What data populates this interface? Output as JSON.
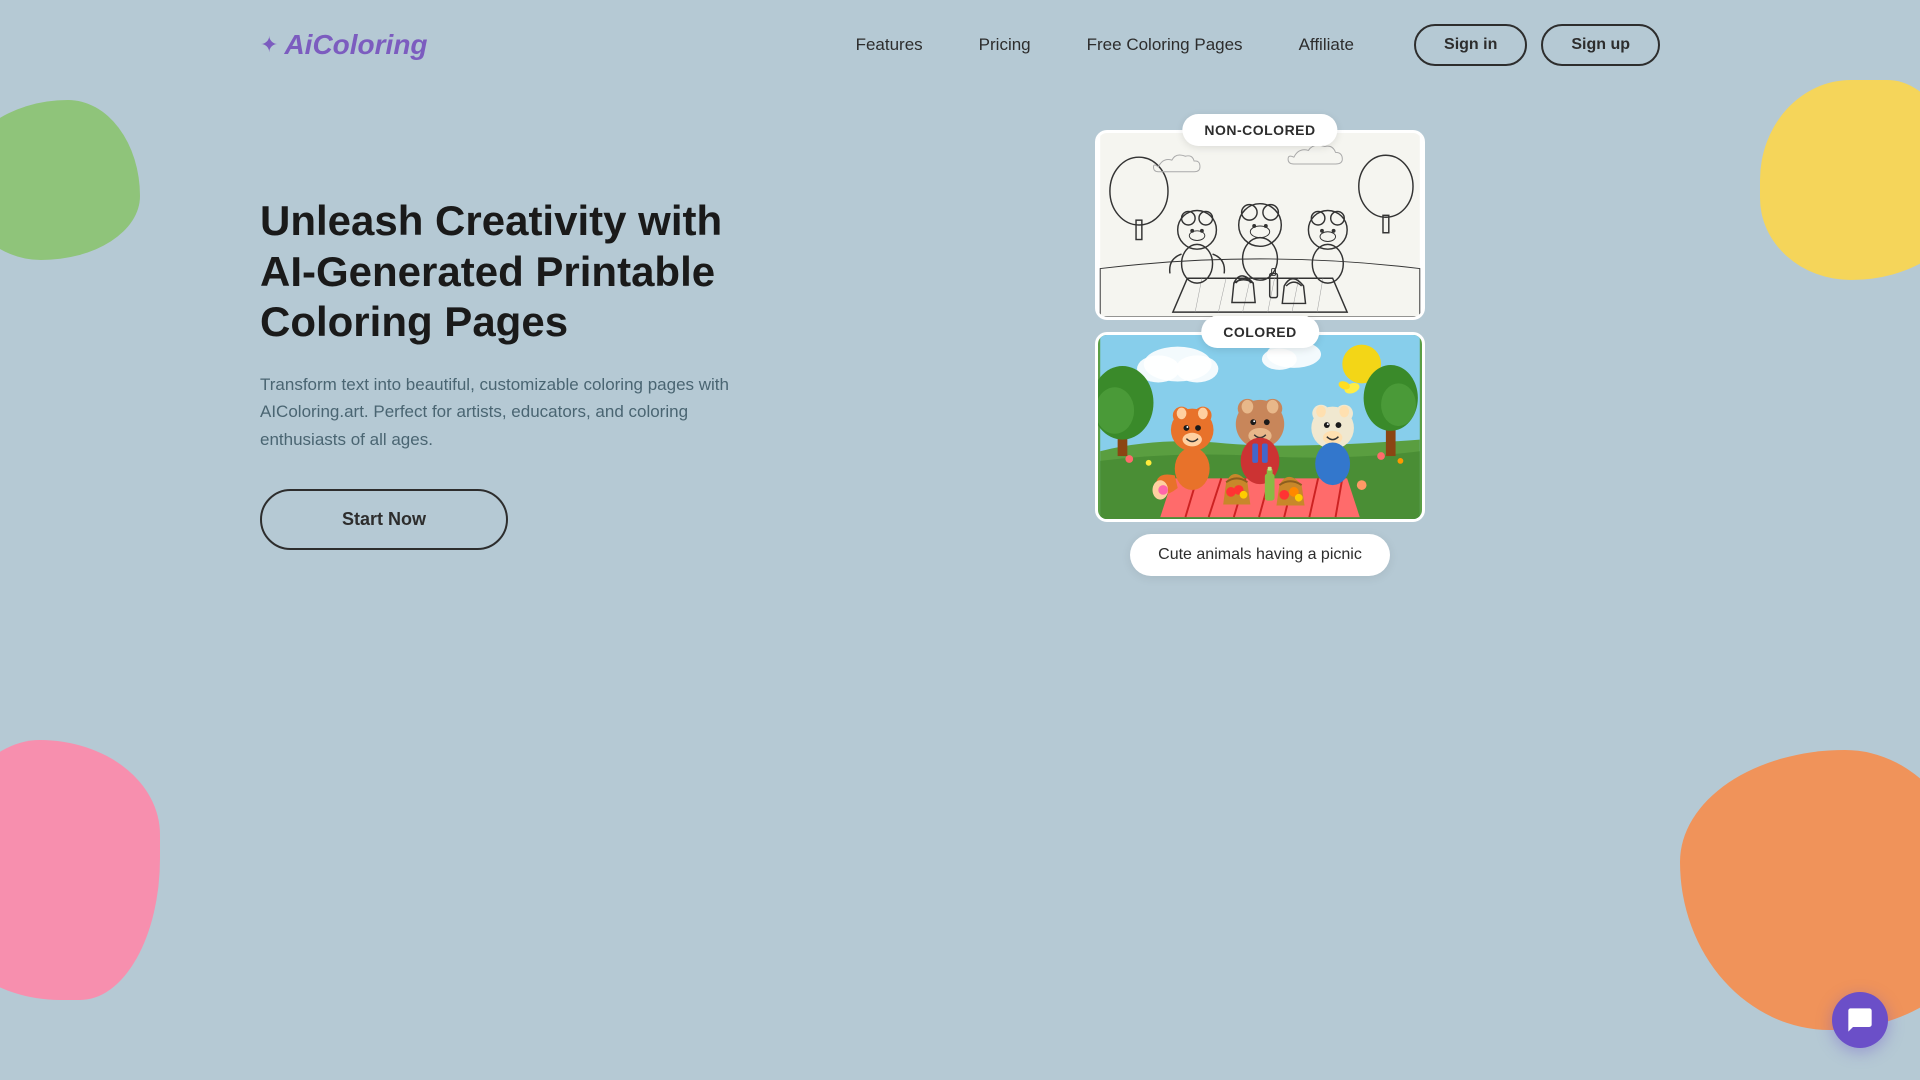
{
  "brand": {
    "name": "AiColoring",
    "logo_star": "✦"
  },
  "nav": {
    "links": [
      {
        "label": "Features",
        "id": "features"
      },
      {
        "label": "Pricing",
        "id": "pricing"
      },
      {
        "label": "Free Coloring Pages",
        "id": "free-coloring"
      },
      {
        "label": "Affiliate",
        "id": "affiliate"
      }
    ],
    "signin_label": "Sign in",
    "signup_label": "Sign up"
  },
  "hero": {
    "title": "Unleash Creativity with AI-Generated Printable Coloring Pages",
    "subtitle": "Transform text into beautiful, customizable coloring pages with AIColoring.art. Perfect for artists, educators, and coloring enthusiasts of all ages.",
    "cta_label": "Start Now",
    "image_noncolored_badge": "NON-COLORED",
    "image_colored_badge": "COLORED",
    "caption": "Cute animals having a picnic"
  },
  "chat_icon": "💬",
  "colors": {
    "accent_purple": "#7c5cbf",
    "background": "#b5c9d4",
    "text_dark": "#1a1a1a",
    "text_muted": "#4a6572"
  }
}
